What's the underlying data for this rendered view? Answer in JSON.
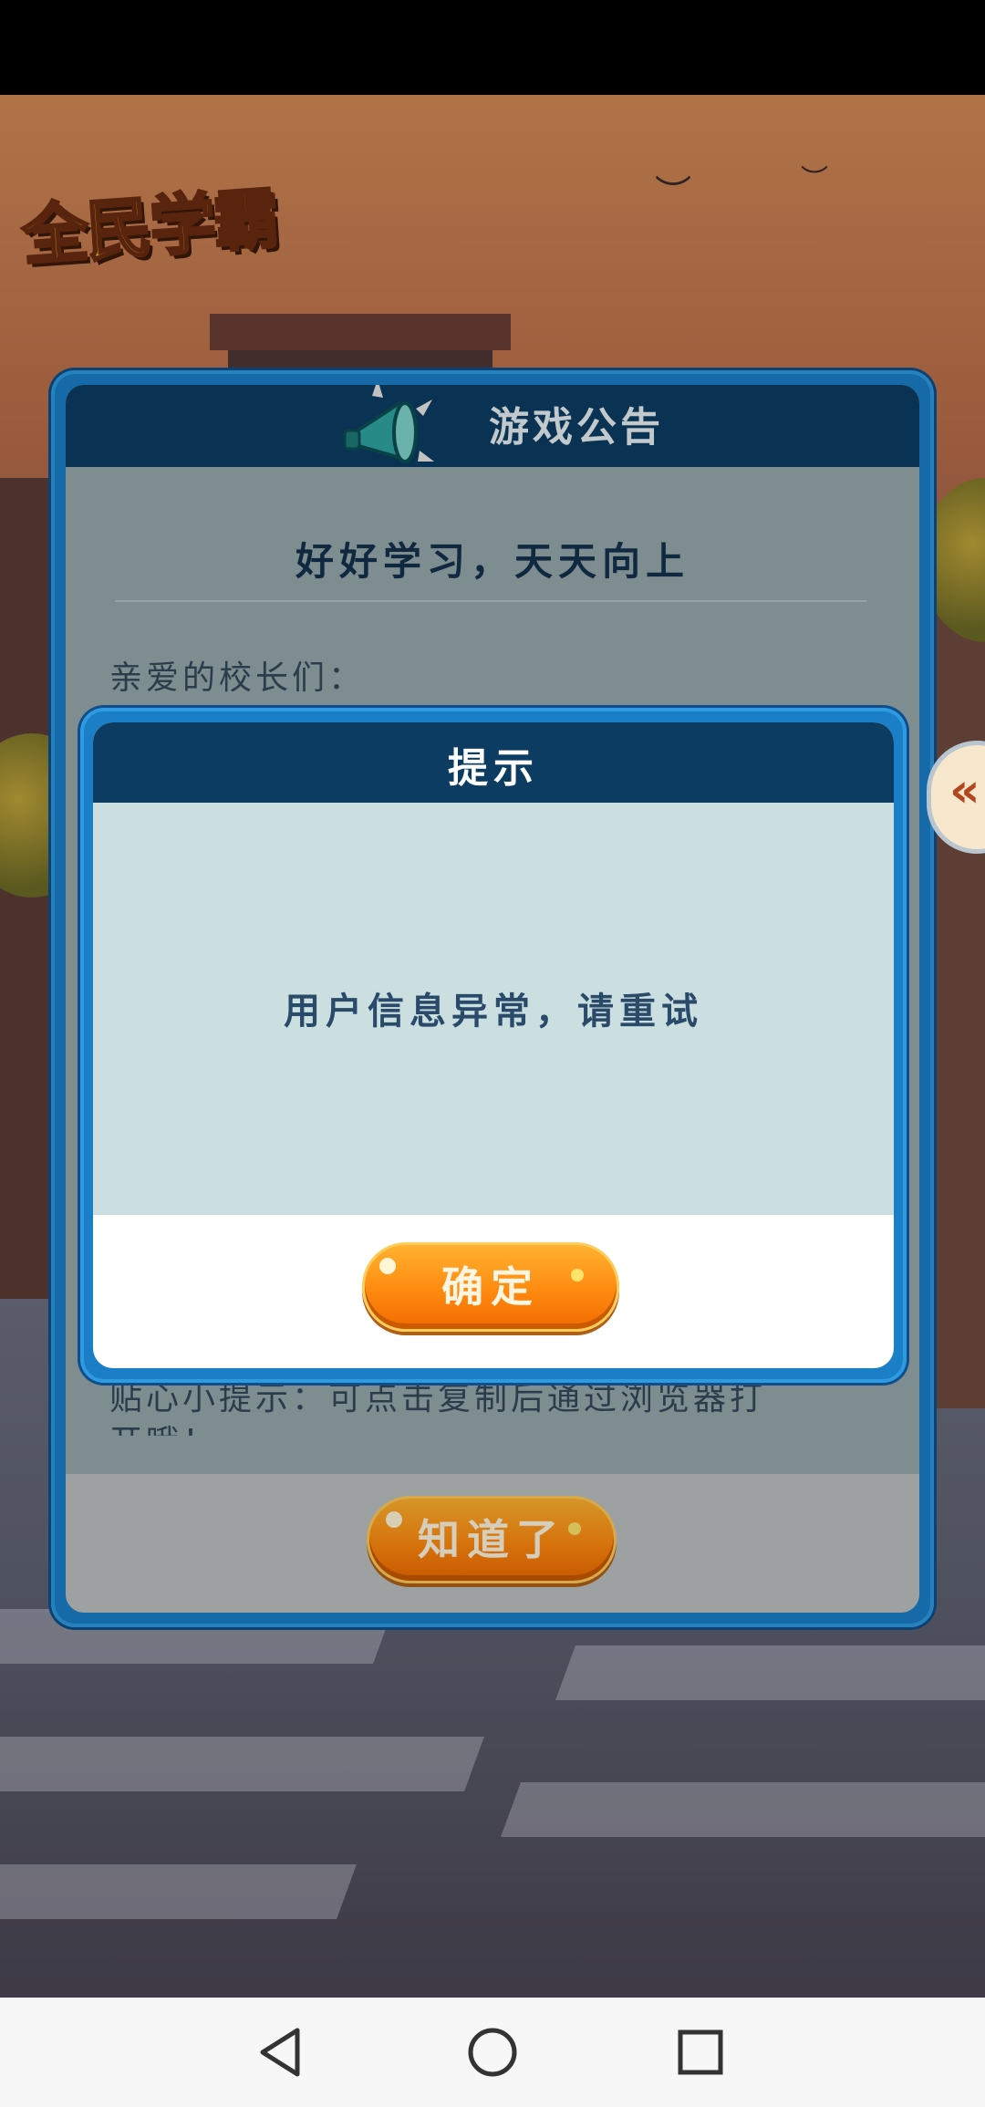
{
  "game": {
    "logo_text": "全民学霸"
  },
  "notice": {
    "title": "游戏公告",
    "subtitle": "好好学习，天天向上",
    "greeting": "亲爱的校长们：",
    "partial_line_1": "贴心小提示：可点击复制后通过浏览器打",
    "partial_line_2": "开哦！",
    "ack_button": "知道了"
  },
  "prompt": {
    "title": "提示",
    "message": "用户信息异常，请重试",
    "confirm_button": "确定"
  },
  "side_tab": {
    "glyph": "«"
  },
  "nav": {
    "back_icon": "triangle-back-icon",
    "home_icon": "circle-home-icon",
    "recents_icon": "square-recents-icon"
  },
  "colors": {
    "header_navy": "#0d3c62",
    "frame_blue": "#1a7fc7",
    "button_orange": "#ff8a10",
    "prompt_body": "#cbdfe0"
  }
}
